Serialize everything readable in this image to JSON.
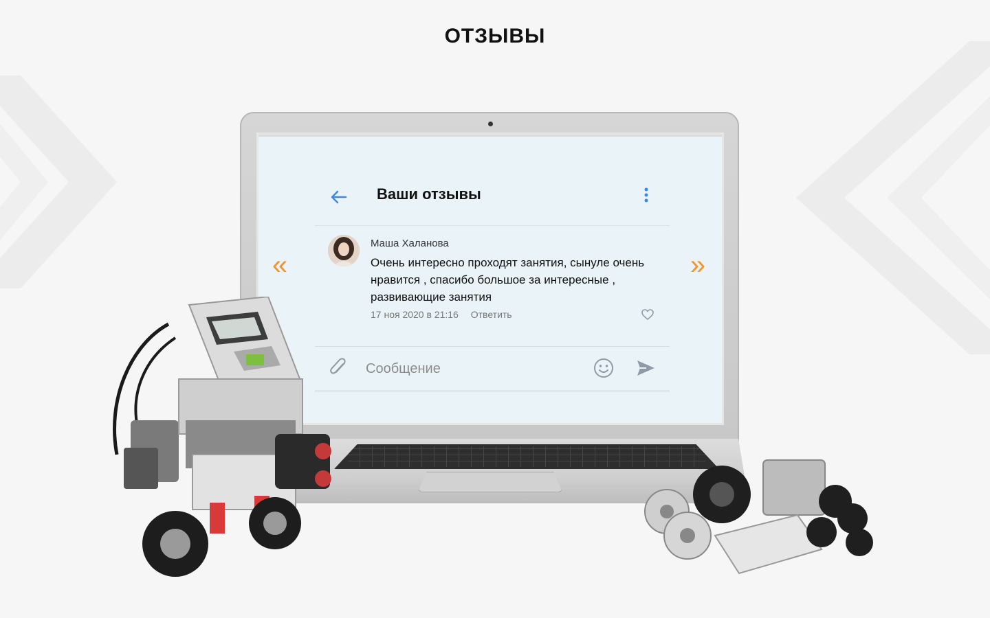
{
  "page": {
    "title": "ОТЗЫВЫ"
  },
  "slider": {
    "prev_label": "«",
    "next_label": "»"
  },
  "app": {
    "header": {
      "title": "Ваши отзывы"
    },
    "comment": {
      "author": "Маша Халанова",
      "text": "Очень интересно проходят занятия, сынуле очень нравится , спасибо большое за интересные , развивающие занятия",
      "date": "17 ноя 2020 в 21:16",
      "reply_label": "Ответить"
    },
    "composer": {
      "placeholder": "Сообщение",
      "value": ""
    }
  },
  "icons": {
    "back": "arrow-left-icon",
    "menu": "kebab-menu-icon",
    "like": "heart-icon",
    "attach": "paperclip-icon",
    "emoji": "smiley-icon",
    "send": "send-icon"
  },
  "colors": {
    "background": "#f6f6f6",
    "accent": "#f0962f",
    "link_blue": "#3f8ae0",
    "icon_gray": "#8e9aa6",
    "screen_bg": "#eaf3f7"
  }
}
